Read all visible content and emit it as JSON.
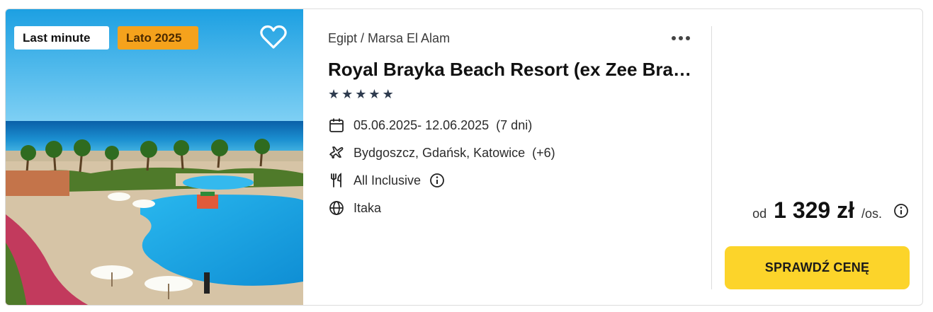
{
  "badges": {
    "last_minute": "Last minute",
    "season": "Lato 2025"
  },
  "hotel": {
    "breadcrumb": "Egipt / Marsa El Alam",
    "name": "Royal Brayka Beach Resort (ex Zee Brayka Bay Resort)",
    "stars": 5
  },
  "trip": {
    "dates": "05.06.2025- 12.06.2025",
    "duration": "(7 dni)",
    "departures": "Bydgoszcz, Gdańsk, Katowice",
    "departures_more": "(+6)",
    "board": "All Inclusive",
    "operator": "Itaka"
  },
  "price": {
    "prefix": "od",
    "amount": "1 329 zł",
    "per": "/os."
  },
  "cta": {
    "label": "SPRAWDŹ CENĘ"
  },
  "icons": {
    "favorite": "heart-icon",
    "more": "more-dots-icon",
    "star": "star-icon",
    "calendar": "calendar-icon",
    "flight": "plane-icon",
    "board": "cutlery-icon",
    "operator": "globe-icon",
    "info": "info-icon"
  },
  "colors": {
    "badge_orange": "#f5a21c",
    "cta_yellow": "#fcd42a",
    "star_color": "#2e3b4e",
    "sea_blue": "#1e8fd0",
    "pool_blue": "#1aa9e6"
  }
}
